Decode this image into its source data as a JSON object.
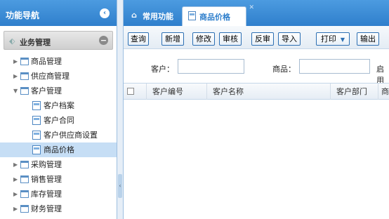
{
  "sidebar": {
    "title": "功能导航",
    "collapse_icon": "chevron-left-icon",
    "group_title": "业务管理",
    "items": [
      {
        "label": "商品管理",
        "level": 1,
        "expanded": false
      },
      {
        "label": "供应商管理",
        "level": 1,
        "expanded": false
      },
      {
        "label": "客户管理",
        "level": 1,
        "expanded": true
      },
      {
        "label": "客户档案",
        "level": 2
      },
      {
        "label": "客户合同",
        "level": 2
      },
      {
        "label": "客户供应商设置",
        "level": 2
      },
      {
        "label": "商品价格",
        "level": 2,
        "selected": true
      },
      {
        "label": "采购管理",
        "level": 1,
        "expanded": false
      },
      {
        "label": "销售管理",
        "level": 1,
        "expanded": false
      },
      {
        "label": "库存管理",
        "level": 1,
        "expanded": false
      },
      {
        "label": "财务管理",
        "level": 1,
        "expanded": false
      }
    ]
  },
  "tabs": [
    {
      "label": "常用功能",
      "icon": "home-icon",
      "active": false
    },
    {
      "label": "商品价格",
      "icon": "file-icon",
      "active": true,
      "closable": true
    }
  ],
  "toolbar": {
    "buttons": [
      "查询",
      "新增",
      "修改",
      "审核",
      "反审",
      "导入",
      "打印",
      "输出"
    ]
  },
  "search": {
    "customer_label": "客户：",
    "customer_value": "",
    "product_label": "商品：",
    "product_value": "",
    "enabled_label": "启用"
  },
  "grid": {
    "columns": [
      "",
      "客户编号",
      "客户名称",
      "客户部门",
      "商"
    ]
  },
  "colors": {
    "header_blue": "#2f7fcc",
    "selected_row": "#c6def5",
    "button_border": "#2c6fb3"
  }
}
